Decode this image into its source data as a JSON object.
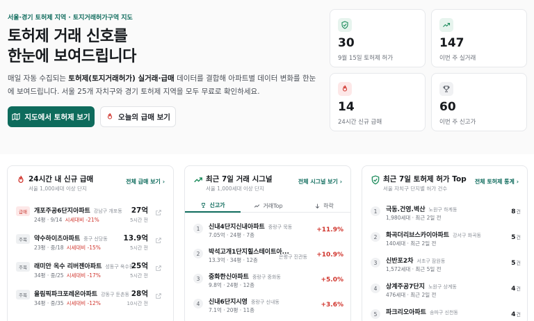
{
  "hero": {
    "eyebrow": "서울·경기 토허제 지역 · 토지거래허가구역 지도",
    "title_line1": "토허제 거래 신호를",
    "title_line2": "한눈에 보여드립니다",
    "desc_prefix": "매일 자동 수집되는 ",
    "desc_bold": "토허제(토지거래허가) 실거래·급매",
    "desc_suffix": " 데이터를 결합해 아파트별 데이터 변화를 한눈에 보여드립니다. 서울 25개 자치구와 경기 토허제 지역을 모두 무료로 확인하세요.",
    "primary_button": "지도에서 토허제 보기",
    "secondary_button": "오늘의 급매 보기"
  },
  "stats": [
    {
      "value": "30",
      "label": "9월 15일 토허제 허가",
      "icon": "shield-check-icon",
      "bg": "#e7f4ee",
      "color": "#1a8a5a"
    },
    {
      "value": "147",
      "label": "이번 주 실거래",
      "icon": "trending-up-icon",
      "bg": "#e7f4ee",
      "color": "#1a8a5a"
    },
    {
      "value": "14",
      "label": "24시간 신규 급매",
      "icon": "flame-icon",
      "bg": "#fde8e8",
      "color": "#d0342c"
    },
    {
      "value": "60",
      "label": "이번 주 신고가",
      "icon": "trophy-icon",
      "bg": "#f0f1f3",
      "color": "#5a5f67"
    }
  ],
  "urgent": {
    "title": "24시간 내 신규 급매",
    "subtitle": "서울 1,000세대 이상 단지",
    "link": "전체 급매 보기",
    "items": [
      {
        "badge": "급매",
        "hot": true,
        "name": "개포주공6단지아파트",
        "loc": "강남구 개포동",
        "meta": "24평 · 9/14",
        "change": "시세대비 -21%",
        "price": "27억",
        "ago": "5시간 전"
      },
      {
        "badge": "주목",
        "hot": false,
        "name": "약수하이츠아파트",
        "loc": "중구 신당동",
        "meta": "23평 · 중/18",
        "change": "시세대비 -15%",
        "price": "13.9억",
        "ago": "5시간 전"
      },
      {
        "badge": "주목",
        "hot": false,
        "name": "래미안 옥수 리버젠아파트",
        "loc": "성동구 옥수동",
        "meta": "34평 · 중/25",
        "change": "시세대비 -17%",
        "price": "25억",
        "ago": "5시간 전"
      },
      {
        "badge": "주목",
        "hot": false,
        "name": "올림픽파크포레온아파트",
        "loc": "강동구 둔촌동",
        "meta": "34평 · 중/35",
        "change": "시세대비 -12%",
        "price": "28억",
        "ago": "10시간 전"
      }
    ]
  },
  "signals": {
    "title": "최근 7일 거래 시그널",
    "subtitle": "서울 1,000세대 이상 단지",
    "link": "전체 시그널 보기",
    "tabs": [
      "신고가",
      "거래Top",
      "하락"
    ],
    "items": [
      {
        "rank": "1",
        "name": "신내4단지신내아파트",
        "loc": "중랑구 묵동",
        "meta": "7.05억 · 24평 · 7층",
        "change": "+11.9%"
      },
      {
        "rank": "2",
        "name": "박석고개1단지힐스테이트아...",
        "loc": "은평구 진관동",
        "meta": "13.3억 · 34평 · 12층",
        "change": "+10.9%"
      },
      {
        "rank": "3",
        "name": "중화한신아파트",
        "loc": "중랑구 중화동",
        "meta": "9.8억 · 24평 · 12층",
        "change": "+5.0%"
      },
      {
        "rank": "4",
        "name": "신내6단지시영",
        "loc": "중랑구 신내동",
        "meta": "7.1억 · 20평 · 11층",
        "change": "+3.6%"
      }
    ]
  },
  "permits": {
    "title": "최근 7일 토허제 허가 Top",
    "subtitle": "서울 자치구 단지별 허가 건수",
    "link": "전체 토허제 통계",
    "unit": "건",
    "items": [
      {
        "rank": "1",
        "name": "극동.건영.벽산",
        "loc": "노원구 하계동",
        "meta": "1,980세대 · 최근 2일 전",
        "count": "8"
      },
      {
        "rank": "2",
        "name": "화곡더리브스카이아파트",
        "loc": "강서구 화곡동",
        "meta": "140세대 · 최근 2일 전",
        "count": "5"
      },
      {
        "rank": "3",
        "name": "신반포2차",
        "loc": "서초구 잠원동",
        "meta": "1,572세대 · 최근 5일 전",
        "count": "5"
      },
      {
        "rank": "4",
        "name": "상계주공7단지",
        "loc": "노원구 상계동",
        "meta": "476세대 · 최근 2일 전",
        "count": "4"
      },
      {
        "rank": "5",
        "name": "파크리오아파트",
        "loc": "송파구 신천동",
        "meta": "",
        "count": "4"
      }
    ]
  }
}
